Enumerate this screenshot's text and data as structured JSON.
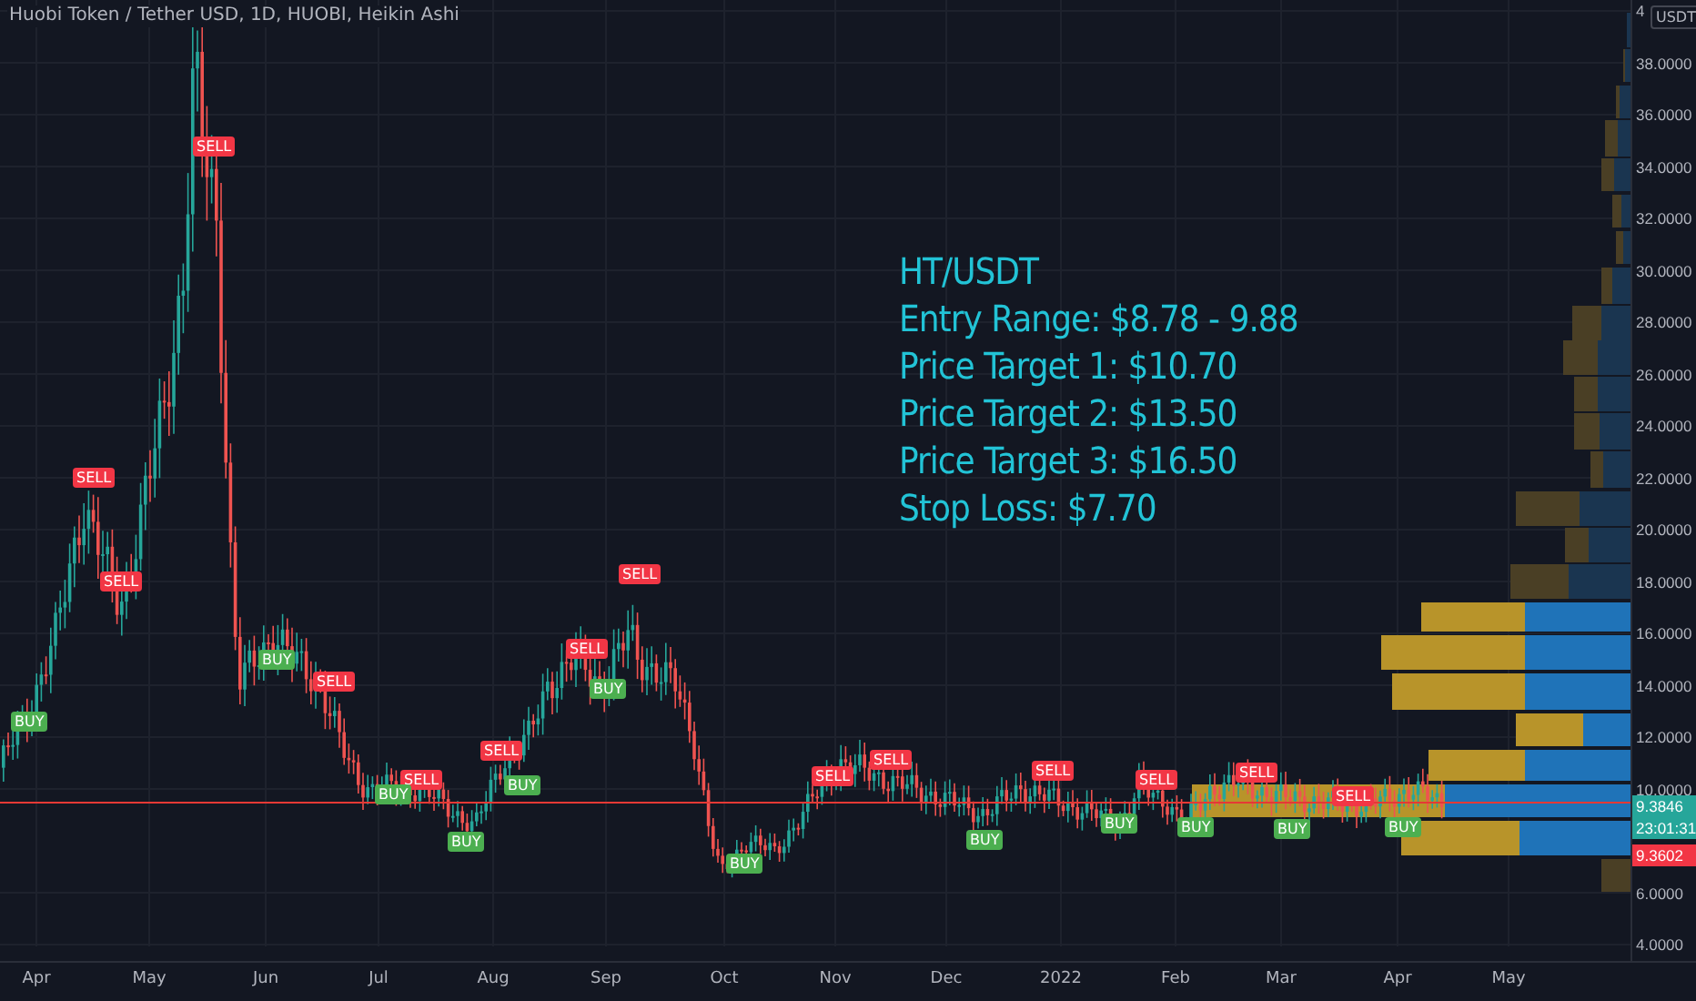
{
  "chart": {
    "title": "Huobi Token / Tether USD, 1D, HUOBI, Heikin Ashi",
    "note_lines": [
      "HT/USDT",
      "Entry Range: $8.78 - 9.88",
      "Price Target 1: $10.70",
      "Price Target 2: $13.50",
      "Price Target 3: $16.50",
      "Stop Loss: $7.70"
    ],
    "signals": [
      {
        "kind": "sell",
        "text": "SELL"
      },
      {
        "kind": "sell",
        "text": "SELL"
      },
      {
        "kind": "sell",
        "text": "SELL"
      },
      {
        "kind": "buy",
        "text": "BUY"
      },
      {
        "kind": "buy",
        "text": "BUY"
      },
      {
        "kind": "sell",
        "text": "SELL"
      },
      {
        "kind": "sell",
        "text": "SELL"
      },
      {
        "kind": "buy",
        "text": "BUY"
      },
      {
        "kind": "buy",
        "text": "BUY"
      },
      {
        "kind": "buy",
        "text": "BUY"
      },
      {
        "kind": "sell",
        "text": "SELL"
      },
      {
        "kind": "sell",
        "text": "SELL"
      },
      {
        "kind": "sell",
        "text": "SELL"
      },
      {
        "kind": "buy",
        "text": "BUY"
      },
      {
        "kind": "sell",
        "text": "SELL"
      },
      {
        "kind": "sell",
        "text": "SELL"
      },
      {
        "kind": "buy",
        "text": "BUY"
      },
      {
        "kind": "buy",
        "text": "BUY"
      },
      {
        "kind": "sell",
        "text": "SELL"
      },
      {
        "kind": "buy",
        "text": "BUY"
      },
      {
        "kind": "sell",
        "text": "SELL"
      },
      {
        "kind": "buy",
        "text": "BUY"
      },
      {
        "kind": "sell",
        "text": "SELL"
      },
      {
        "kind": "buy",
        "text": "BUY"
      },
      {
        "kind": "sell",
        "text": "SELL"
      },
      {
        "kind": "buy",
        "text": "BUY"
      }
    ]
  },
  "price_axis": {
    "currency": "USDT",
    "ticks": [
      "4",
      "38.0000",
      "36.0000",
      "34.0000",
      "32.0000",
      "30.0000",
      "28.0000",
      "26.0000",
      "24.0000",
      "22.0000",
      "20.0000",
      "18.0000",
      "16.0000",
      "14.0000",
      "12.0000",
      "10.0000",
      "6.0000",
      "4.0000"
    ],
    "labels": [
      {
        "kind": "last",
        "text": "9.3846"
      },
      {
        "kind": "countdown",
        "text": "23:01:31"
      },
      {
        "kind": "other",
        "text": "9.3602"
      }
    ]
  },
  "time_axis": {
    "labels": [
      "Apr",
      "May",
      "Jun",
      "Jul",
      "Aug",
      "Sep",
      "Oct",
      "Nov",
      "Dec",
      "2022",
      "Feb",
      "Mar",
      "Apr",
      "May"
    ]
  }
}
